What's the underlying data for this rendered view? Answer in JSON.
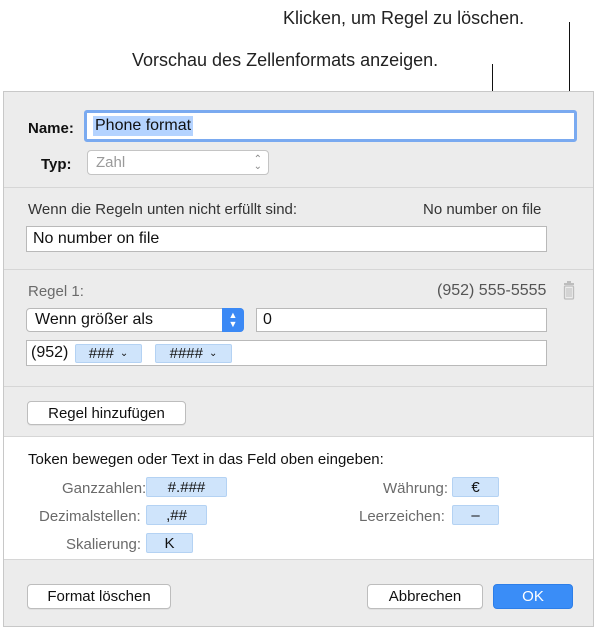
{
  "callouts": {
    "delete_rule": "Klicken, um Regel zu löschen.",
    "preview_format": "Vorschau des Zellenformats anzeigen."
  },
  "dialog": {
    "name_label": "Name:",
    "name_value": "Phone format",
    "type_label": "Typ:",
    "type_value": "Zahl",
    "unmet_label": "Wenn die Regeln unten nicht erfüllt sind:",
    "unmet_preview": "No number on file",
    "unmet_value": "No number on file",
    "rule": {
      "label": "Regel 1:",
      "preview": "(952) 555-5555",
      "condition": "Wenn größer als",
      "threshold": "0",
      "format_prefix": "(952)",
      "token1": "###",
      "token2": "####"
    },
    "add_rule_button": "Regel hinzufügen",
    "tokens_hint": "Token bewegen oder Text in das Feld oben eingeben:",
    "tokens": {
      "integers_label": "Ganzzahlen:",
      "integers_value": "#.###",
      "decimals_label": "Dezimalstellen:",
      "decimals_value": ",##",
      "scaling_label": "Skalierung:",
      "scaling_value": "K",
      "currency_label": "Währung:",
      "currency_value": "€",
      "space_label": "Leerzeichen:",
      "space_value": "–"
    },
    "delete_format_button": "Format löschen",
    "cancel_button": "Abbrechen",
    "ok_button": "OK"
  },
  "colors": {
    "accent": "#3a8df7",
    "token_bg": "#cfe4fb",
    "dialog_bg": "#ececec"
  }
}
